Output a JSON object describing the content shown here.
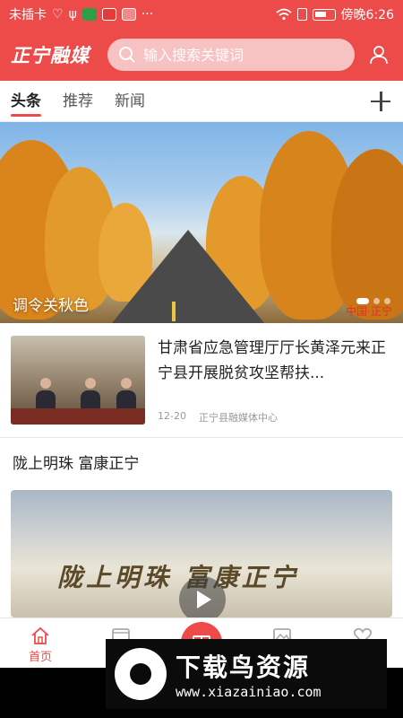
{
  "status_bar": {
    "carrier": "未插卡",
    "time": "傍晚6:26",
    "icons": [
      "heart-monitor-icon",
      "usb-icon",
      "green-app-icon",
      "red-app-icon",
      "pink-app-icon",
      "more-icon",
      "wifi-icon",
      "sim-icon",
      "battery-icon"
    ]
  },
  "header": {
    "logo": "正宁融媒",
    "search_placeholder": "输入搜索关键词",
    "colors": {
      "brand": "#ed4b4a"
    }
  },
  "tabs": [
    {
      "label": "头条",
      "active": true
    },
    {
      "label": "推荐",
      "active": false
    },
    {
      "label": "新闻",
      "active": false
    }
  ],
  "banner": {
    "caption": "调令关秋色",
    "watermark": "中国·正宁",
    "slides": 3,
    "active_slide": 0
  },
  "news": {
    "title": "甘肃省应急管理厅厅长黄泽元来正宁县开展脱贫攻坚帮扶...",
    "date": "12-20",
    "source": "正宁县融媒体中心"
  },
  "section": {
    "title": "陇上明珠 富康正宁"
  },
  "video": {
    "title": "陇上明珠 富康正宁"
  },
  "bottom_nav": [
    {
      "label": "首页",
      "icon": "home-icon",
      "active": true
    },
    {
      "label": "",
      "icon": "video-icon",
      "active": false
    },
    {
      "label": "",
      "icon": "book-icon",
      "active": false
    },
    {
      "label": "",
      "icon": "image-icon",
      "active": false
    },
    {
      "label": "",
      "icon": "heart-icon",
      "active": false
    }
  ],
  "overlay": {
    "brand": "下载鸟资源",
    "url": "www.xiazainiao.com"
  }
}
